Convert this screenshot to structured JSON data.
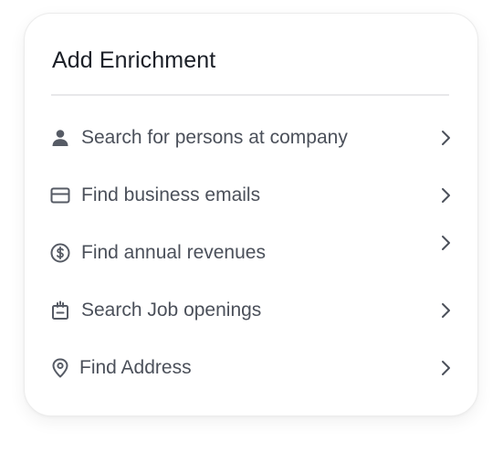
{
  "panel": {
    "title": "Add Enrichment"
  },
  "items": [
    {
      "label": "Search for persons at company",
      "icon": "person-icon"
    },
    {
      "label": "Find business emails",
      "icon": "mail-icon"
    },
    {
      "label": "Find annual revenues",
      "icon": "dollar-circle-icon"
    },
    {
      "label": "Search Job openings",
      "icon": "calendar-job-icon"
    },
    {
      "label": "Find Address",
      "icon": "map-pin-icon"
    }
  ],
  "colors": {
    "title": "#1b1f27",
    "label": "#4b505a",
    "icon": "#565b65",
    "chevron": "#4b505a",
    "divider": "#e8e8ea"
  }
}
